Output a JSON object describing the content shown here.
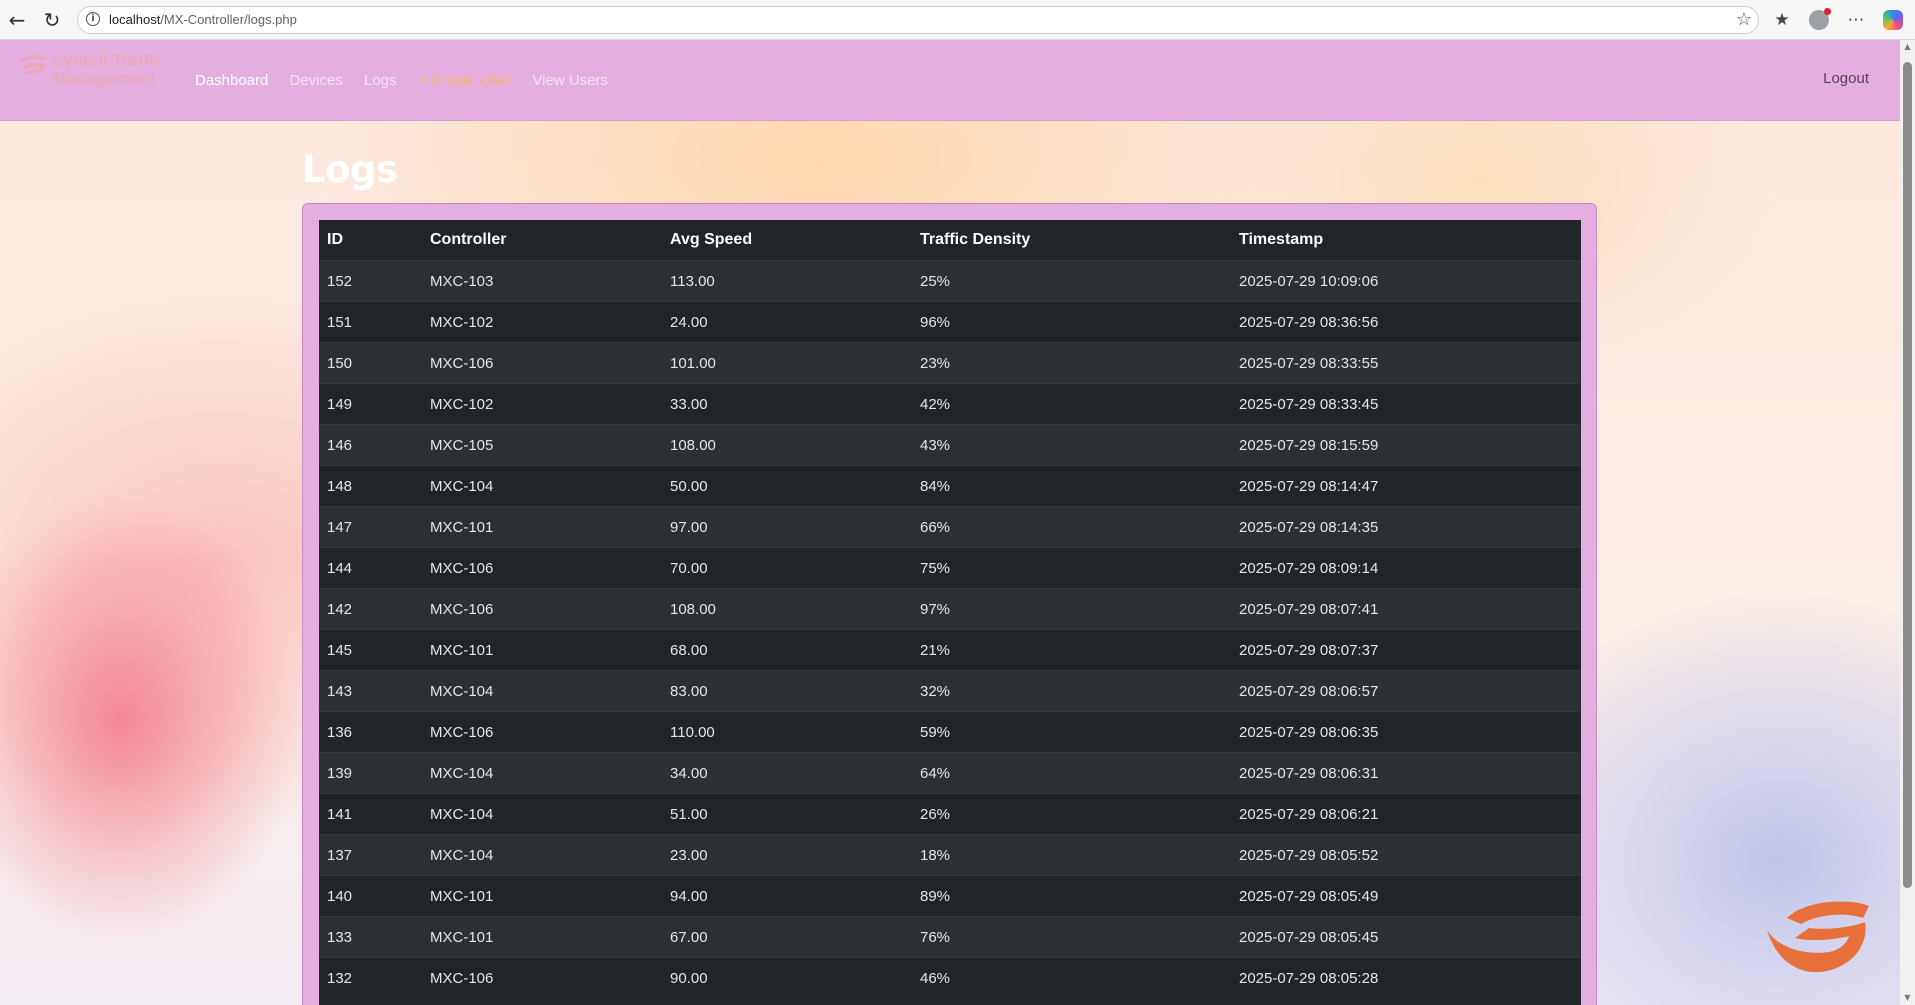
{
  "browser": {
    "url_host": "localhost",
    "url_path": "/MX-Controller/logs.php"
  },
  "navbar": {
    "brand": "Syntell Traffic Management",
    "links": [
      {
        "label": "Dashboard",
        "state": "active"
      },
      {
        "label": "Devices",
        "state": "normal"
      },
      {
        "label": "Logs",
        "state": "normal"
      },
      {
        "label": "+ Create User",
        "state": "highlight"
      },
      {
        "label": "View Users",
        "state": "normal"
      }
    ],
    "logout": "Logout"
  },
  "page": {
    "title": "Logs"
  },
  "table": {
    "columns": [
      "ID",
      "Controller",
      "Avg Speed",
      "Traffic Density",
      "Timestamp"
    ],
    "rows": [
      [
        "152",
        "MXC-103",
        "113.00",
        "25%",
        "2025-07-29 10:09:06"
      ],
      [
        "151",
        "MXC-102",
        "24.00",
        "96%",
        "2025-07-29 08:36:56"
      ],
      [
        "150",
        "MXC-106",
        "101.00",
        "23%",
        "2025-07-29 08:33:55"
      ],
      [
        "149",
        "MXC-102",
        "33.00",
        "42%",
        "2025-07-29 08:33:45"
      ],
      [
        "146",
        "MXC-105",
        "108.00",
        "43%",
        "2025-07-29 08:15:59"
      ],
      [
        "148",
        "MXC-104",
        "50.00",
        "84%",
        "2025-07-29 08:14:47"
      ],
      [
        "147",
        "MXC-101",
        "97.00",
        "66%",
        "2025-07-29 08:14:35"
      ],
      [
        "144",
        "MXC-106",
        "70.00",
        "75%",
        "2025-07-29 08:09:14"
      ],
      [
        "142",
        "MXC-106",
        "108.00",
        "97%",
        "2025-07-29 08:07:41"
      ],
      [
        "145",
        "MXC-101",
        "68.00",
        "21%",
        "2025-07-29 08:07:37"
      ],
      [
        "143",
        "MXC-104",
        "83.00",
        "32%",
        "2025-07-29 08:06:57"
      ],
      [
        "136",
        "MXC-106",
        "110.00",
        "59%",
        "2025-07-29 08:06:35"
      ],
      [
        "139",
        "MXC-104",
        "34.00",
        "64%",
        "2025-07-29 08:06:31"
      ],
      [
        "141",
        "MXC-104",
        "51.00",
        "26%",
        "2025-07-29 08:06:21"
      ],
      [
        "137",
        "MXC-104",
        "23.00",
        "18%",
        "2025-07-29 08:05:52"
      ],
      [
        "140",
        "MXC-101",
        "94.00",
        "89%",
        "2025-07-29 08:05:49"
      ],
      [
        "133",
        "MXC-101",
        "67.00",
        "76%",
        "2025-07-29 08:05:45"
      ],
      [
        "132",
        "MXC-106",
        "90.00",
        "46%",
        "2025-07-29 08:05:28"
      ]
    ]
  },
  "colors": {
    "navbar_bg": "#e4aee0",
    "table_bg": "#212529",
    "table_stripe": "#2c3034",
    "highlight_link": "#f3b46a",
    "logo_accent": "#e8703a"
  },
  "icons": {
    "back": "arrow-left-icon",
    "reload": "reload-icon",
    "site_info": "info-icon",
    "bookmark": "star-icon",
    "favorites": "favorites-icon",
    "profile": "profile-icon",
    "more": "more-icon",
    "copilot": "copilot-icon",
    "brand": "syntell-logo-icon"
  }
}
